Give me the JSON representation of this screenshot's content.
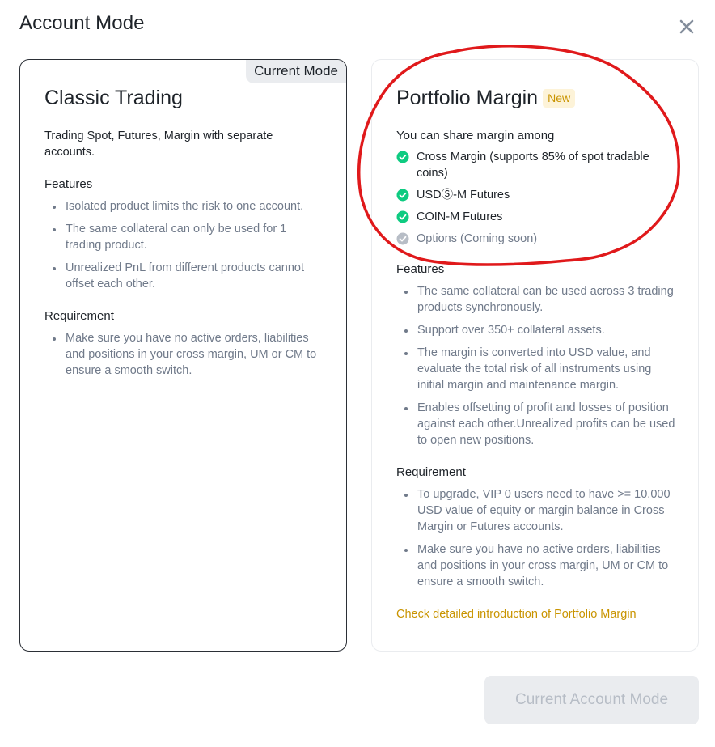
{
  "modal": {
    "title": "Account Mode",
    "close_icon": "close-icon"
  },
  "classic": {
    "current_tag": "Current Mode",
    "title": "Classic Trading",
    "description": "Trading Spot, Futures, Margin with separate accounts.",
    "features_title": "Features",
    "features": [
      "Isolated product limits the risk to one account.",
      "The same collateral can only be used for 1 trading product.",
      "Unrealized PnL from different products cannot offset each other."
    ],
    "requirement_title": "Requirement",
    "requirements": [
      "Make sure you have no active orders, liabilities and positions in your cross margin, UM or CM to ensure a smooth switch."
    ]
  },
  "portfolio": {
    "title": "Portfolio Margin",
    "badge": "New",
    "share_title": "You can share margin among",
    "share_items": [
      {
        "label": "Cross Margin (supports 85% of spot tradable coins)",
        "icon": "check-circle-icon",
        "enabled": true
      },
      {
        "label": "USDⓈ-M Futures",
        "icon": "check-circle-icon",
        "enabled": true
      },
      {
        "label": "COIN-M Futures",
        "icon": "check-circle-icon",
        "enabled": true
      },
      {
        "label": "Options (Coming soon)",
        "icon": "check-circle-icon",
        "enabled": false
      }
    ],
    "features_title": "Features",
    "features": [
      "The same collateral can be used across 3 trading products synchronously.",
      "Support over 350+ collateral assets.",
      "The margin is converted into USD value, and evaluate the total risk of all instruments using initial margin and maintenance margin.",
      "Enables offsetting of profit and losses of position against each other.Unrealized profits can be used to open new positions."
    ],
    "requirement_title": "Requirement",
    "requirements": [
      "To upgrade, VIP 0 users need to have >= 10,000 USD value of equity or margin balance in Cross Margin or Futures accounts.",
      "Make sure you have no active orders, liabilities and positions in your cross margin, UM or CM to ensure a smooth switch."
    ],
    "link": "Check detailed introduction of Portfolio Margin"
  },
  "footer": {
    "button_label": "Current Account Mode"
  },
  "colors": {
    "primary_text": "#1e2329",
    "secondary_text": "#707a8a",
    "accent": "#c99400",
    "check_green": "#0ecb81",
    "check_disabled": "#b7bdc6",
    "annotation_red": "#e0191b",
    "button_bg": "#eaecef",
    "button_text": "#b7bdc6"
  }
}
